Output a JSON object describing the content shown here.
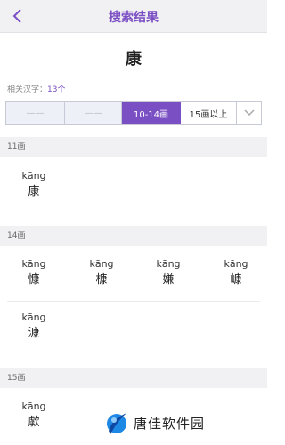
{
  "header": {
    "title": "搜索结果"
  },
  "query_char": "康",
  "related": {
    "label": "相关汉字：",
    "count": "13个"
  },
  "filter": {
    "seg1": "——",
    "seg2": "——",
    "seg3": "10-14画",
    "seg4": "15画以上",
    "active": "10-14画"
  },
  "sections": [
    {
      "title": "11画",
      "chars": [
        {
          "pinyin": "kāng",
          "char": "康"
        }
      ]
    },
    {
      "title": "14画",
      "chars": [
        {
          "pinyin": "kāng",
          "char": "慷"
        },
        {
          "pinyin": "kāng",
          "char": "槺"
        },
        {
          "pinyin": "kāng",
          "char": "嫌"
        },
        {
          "pinyin": "kāng",
          "char": "嵻"
        },
        {
          "pinyin": "kāng",
          "char": "漮"
        }
      ]
    },
    {
      "title": "15画",
      "chars": [
        {
          "pinyin": "kāng",
          "char": "歑"
        }
      ]
    }
  ],
  "watermark": {
    "text": "唐佳软件园"
  },
  "colors": {
    "accent": "#7b4fc4",
    "section_bg": "#f1f1f3"
  }
}
